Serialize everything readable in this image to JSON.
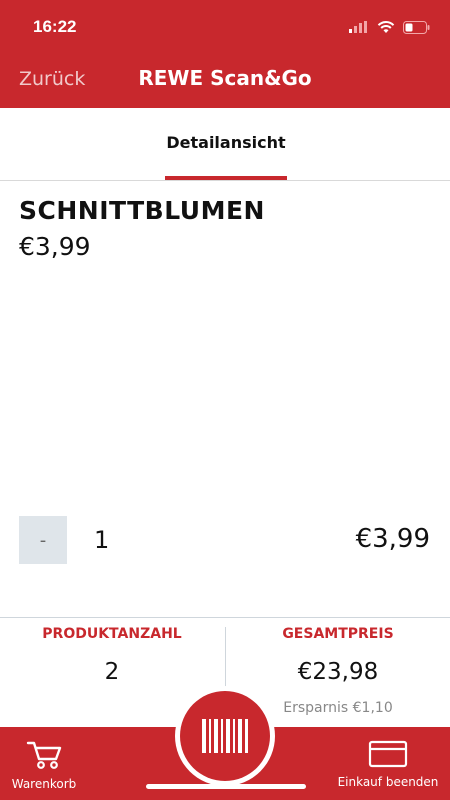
{
  "status": {
    "time": "16:22"
  },
  "nav": {
    "back_label": "Zurück",
    "title": "REWE Scan&Go"
  },
  "tab": {
    "label": "Detailansicht"
  },
  "product": {
    "name": "SCHNITTBLUMEN",
    "price": "€3,99",
    "quantity": "1",
    "minus_label": "-",
    "line_total": "€3,99"
  },
  "summary": {
    "count_label": "PRODUKTANZAHL",
    "count_value": "2",
    "total_label": "GESAMTPREIS",
    "total_value": "€23,98",
    "savings": "Ersparnis €1,10"
  },
  "tabbar": {
    "cart_label": "Warenkorb",
    "finish_label": "Einkauf beenden"
  },
  "colors": {
    "brand_red": "#c8282d",
    "muted_button": "#dfe5ea"
  },
  "icons": [
    "signal-icon",
    "wifi-icon",
    "battery-icon",
    "cart-icon",
    "barcode-icon",
    "card-icon"
  ]
}
